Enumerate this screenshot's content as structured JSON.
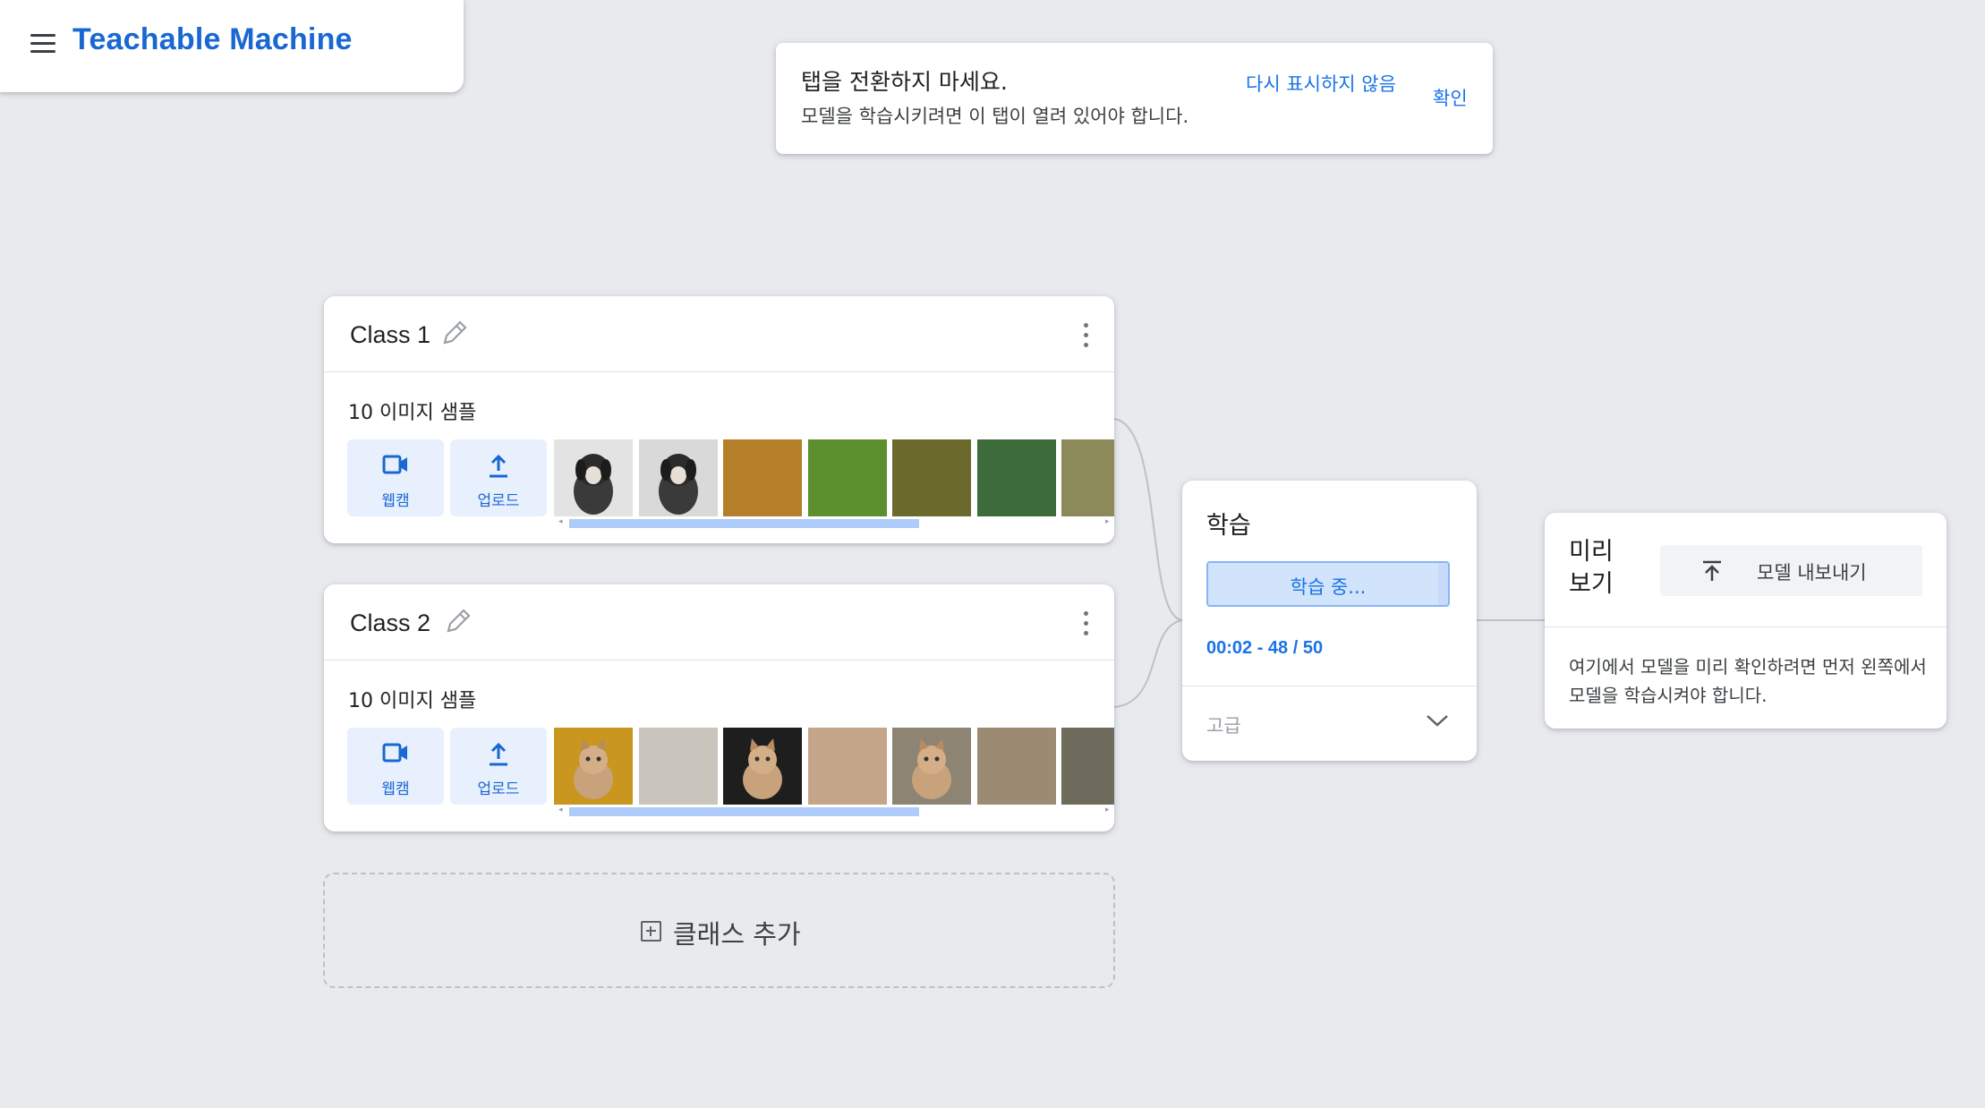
{
  "header": {
    "title": "Teachable Machine",
    "icon": "menu-icon"
  },
  "toast": {
    "title": "탭을 전환하지 마세요.",
    "message": "모델을 학습시키려면 이 탭이 열려 있어야 합니다.",
    "dismiss_label": "다시 표시하지 않음",
    "confirm_label": "확인"
  },
  "classes": [
    {
      "name": "Class 1",
      "sample_count": "10 이미지 샘플",
      "webcam_label": "웹캠",
      "upload_label": "업로드"
    },
    {
      "name": "Class 2",
      "sample_count": "10 이미지 샘플",
      "webcam_label": "웹캠",
      "upload_label": "업로드"
    }
  ],
  "add_class": {
    "label": "클래스 추가"
  },
  "training": {
    "title": "학습",
    "button_label": "학습 중...",
    "progress_text": "00:02 - 48 / 50",
    "progress_fraction": 0.96,
    "advanced_label": "고급"
  },
  "preview": {
    "title": "미리 보기",
    "export_label": "모델 내보내기",
    "message": "여기에서 모델을 미리 확인하려면 먼저 왼쪽에서 모델을 학습시켜야 합니다."
  },
  "colors": {
    "accent": "#1a73e8",
    "brand": "#1967d2",
    "background": "#e8eaed",
    "tool_button": "#e8f0fe"
  }
}
